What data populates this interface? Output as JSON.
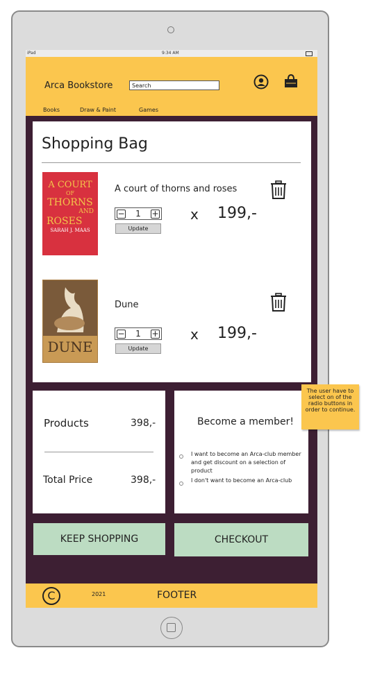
{
  "statusbar": {
    "device": "iPad",
    "time": "9:34 AM"
  },
  "header": {
    "brand": "Arca Bookstore",
    "search_placeholder": "Search",
    "nav": [
      "Books",
      "Draw & Paint",
      "Games"
    ]
  },
  "bag": {
    "title": "Shopping Bag",
    "items": [
      {
        "name": "A court of thorns and roses",
        "quantity": "1",
        "update_label": "Update",
        "multiplier": "x",
        "price": "199,-",
        "cover": {
          "lines": [
            "A COURT",
            "OF",
            "THORNS",
            "AND",
            "ROSES"
          ],
          "author": "SARAH J. MAAS",
          "color": "#d8313f"
        }
      },
      {
        "name": "Dune",
        "quantity": "1",
        "update_label": "Update",
        "multiplier": "x",
        "price": "199,-",
        "cover": {
          "title": "DUNE",
          "color": "#c99a55"
        }
      }
    ]
  },
  "summary": {
    "products_label": "Products",
    "products_value": "398,-",
    "total_label": "Total Price",
    "total_value": "398,-"
  },
  "membership": {
    "title": "Become a member!",
    "options": [
      "I want to become an Arca-club member and get discount on a selection of product",
      "I don't want to become an Arca-club"
    ]
  },
  "buttons": {
    "keep_shopping": "KEEP SHOPPING",
    "checkout": "CHECKOUT"
  },
  "footer": {
    "copyright_icon": "©",
    "year": "2021",
    "label": "FOOTER"
  },
  "annotation": "The user have to select on of the radio buttons in order to continue.",
  "colors": {
    "accent": "#fbc64e",
    "background": "#3d1f33",
    "button": "#bcdcc2"
  }
}
